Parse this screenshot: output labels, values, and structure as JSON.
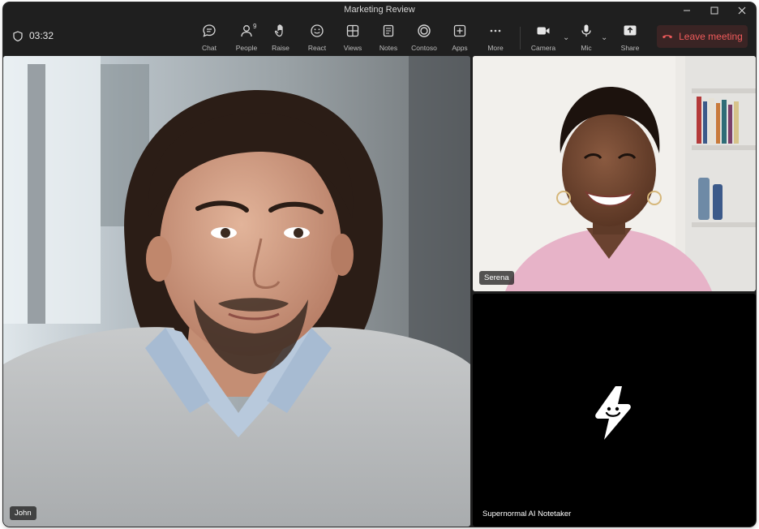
{
  "window": {
    "title": "Marketing Review",
    "controls": [
      "minimize-icon",
      "maximize-icon",
      "close-icon"
    ]
  },
  "meeting": {
    "timer": "03:32",
    "timer_icon": "shield-icon"
  },
  "toolbar": {
    "chat": {
      "label": "Chat",
      "icon": "chat-bubble-icon"
    },
    "people": {
      "label": "People",
      "icon": "people-icon",
      "count": "9"
    },
    "raise": {
      "label": "Raise",
      "icon": "raise-hand-icon"
    },
    "react": {
      "label": "React",
      "icon": "smiley-icon"
    },
    "views": {
      "label": "Views",
      "icon": "grid-view-icon"
    },
    "notes": {
      "label": "Notes",
      "icon": "notes-icon"
    },
    "contoso": {
      "label": "Contoso",
      "icon": "contoso-app-icon"
    },
    "apps": {
      "label": "Apps",
      "icon": "add-app-icon"
    },
    "more": {
      "label": "More",
      "icon": "more-dots-icon"
    },
    "camera": {
      "label": "Camera",
      "icon": "camera-icon"
    },
    "mic": {
      "label": "Mic",
      "icon": "microphone-icon"
    },
    "share": {
      "label": "Share",
      "icon": "share-tray-icon"
    },
    "leave": {
      "label": "Leave meeting",
      "icon": "hang-up-phone-icon"
    }
  },
  "participants": [
    {
      "name": "John",
      "type": "video"
    },
    {
      "name": "Serena",
      "type": "video"
    },
    {
      "name": "Supernormal AI Notetaker",
      "type": "bot",
      "icon": "supernormal-logo-icon"
    }
  ],
  "colors": {
    "window_bg": "#1f1f1f",
    "leave_bg": "#3a2424",
    "leave_text": "#ef5b5b",
    "bot_tile_bg": "#000000"
  }
}
